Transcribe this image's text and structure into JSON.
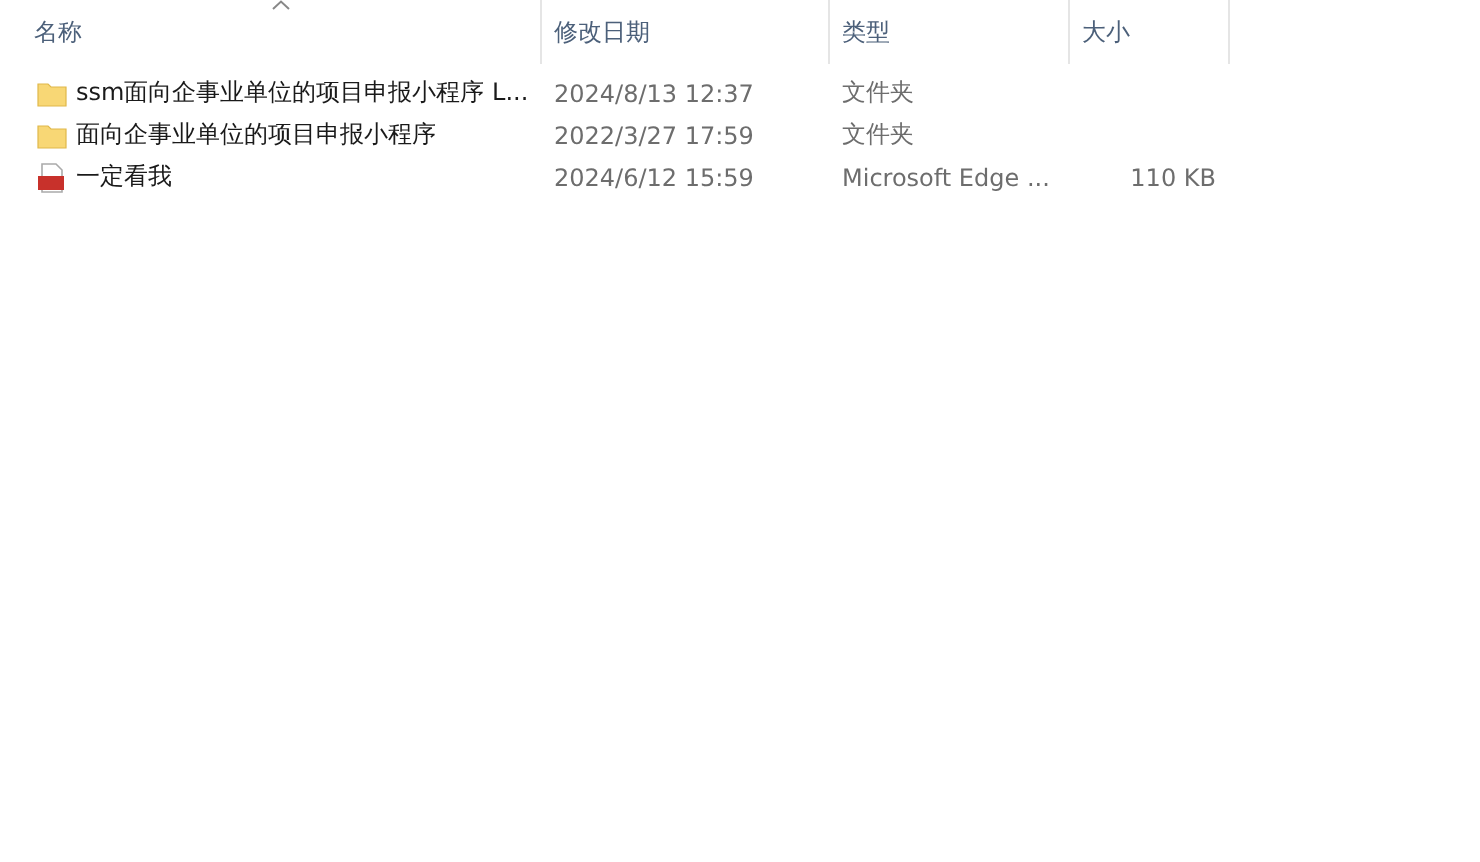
{
  "columns": [
    {
      "label": "名称",
      "sorted": true
    },
    {
      "label": "修改日期",
      "sorted": false
    },
    {
      "label": "类型",
      "sorted": false
    },
    {
      "label": "大小",
      "sorted": false
    }
  ],
  "rows": [
    {
      "kind": "folder",
      "name": "ssm面向企事业单位的项目申报小程序  L...",
      "modified": "2024/8/13 12:37",
      "type": "文件夹"
    },
    {
      "kind": "folder",
      "name": "面向企事业单位的项目申报小程序",
      "modified": "2022/3/27 17:59",
      "type": "文件夹"
    },
    {
      "kind": "pdf",
      "name": "一定看我",
      "modified": "2024/6/12 15:59",
      "type": "Microsoft Edge ...",
      "size": "110 KB"
    }
  ]
}
